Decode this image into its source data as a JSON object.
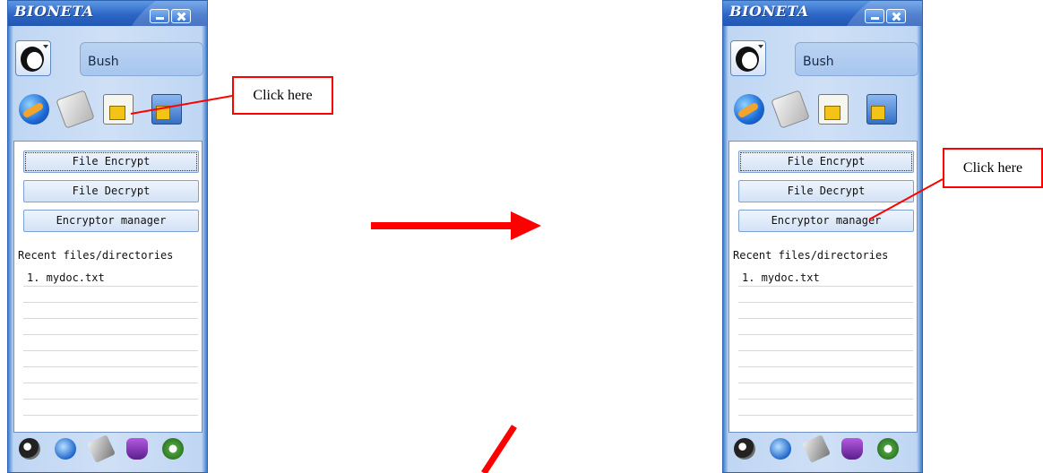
{
  "app": {
    "title": "BIONETA",
    "user_name": "Bush",
    "buttons": {
      "file_encrypt": "File Encrypt",
      "file_decrypt": "File Decrypt",
      "encryptor_manager": "Encryptor manager"
    },
    "recent_header": "Recent files/directories",
    "recent_files": [
      "1. mydoc.txt",
      "",
      "",
      "",
      "",
      "",
      "",
      "",
      "",
      ""
    ],
    "tool_icons": [
      "refresh-globe-icon",
      "briefcase-icon",
      "file-lock-icon",
      "computer-lock-icon"
    ],
    "bottom_icons": [
      "help-icon",
      "network-icon",
      "pen-icon",
      "hand-icon",
      "settings-icon"
    ]
  },
  "annotations": {
    "callout_left": "Click here",
    "callout_right": "Click here",
    "color": "#ff0000"
  }
}
